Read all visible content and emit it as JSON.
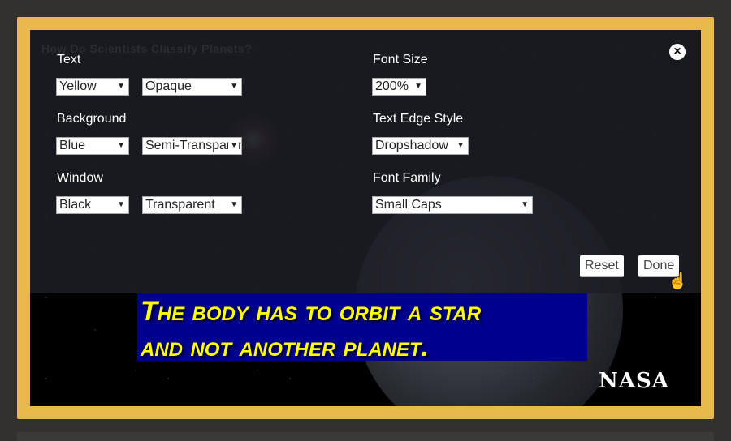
{
  "video": {
    "ghost_title": "How Do Scientists Classify Planets?",
    "caption_lines": [
      "The body has to orbit a star",
      "and not another planet."
    ],
    "logo": "NASA"
  },
  "settings": {
    "text": {
      "label": "Text",
      "color": "Yellow",
      "opacity": "Opaque"
    },
    "background": {
      "label": "Background",
      "color": "Blue",
      "opacity": "Semi-Transparent"
    },
    "window": {
      "label": "Window",
      "color": "Black",
      "opacity": "Transparent"
    },
    "font_size": {
      "label": "Font Size",
      "value": "200%"
    },
    "edge_style": {
      "label": "Text Edge Style",
      "value": "Dropshadow"
    },
    "font_family": {
      "label": "Font Family",
      "value": "Small Caps"
    },
    "reset": "Reset",
    "done": "Done",
    "close_icon": "×",
    "arrow": "▼"
  },
  "colors": {
    "frame": "#e9b94d",
    "caption_bg": "#00008f",
    "caption_text": "#ffff00"
  }
}
